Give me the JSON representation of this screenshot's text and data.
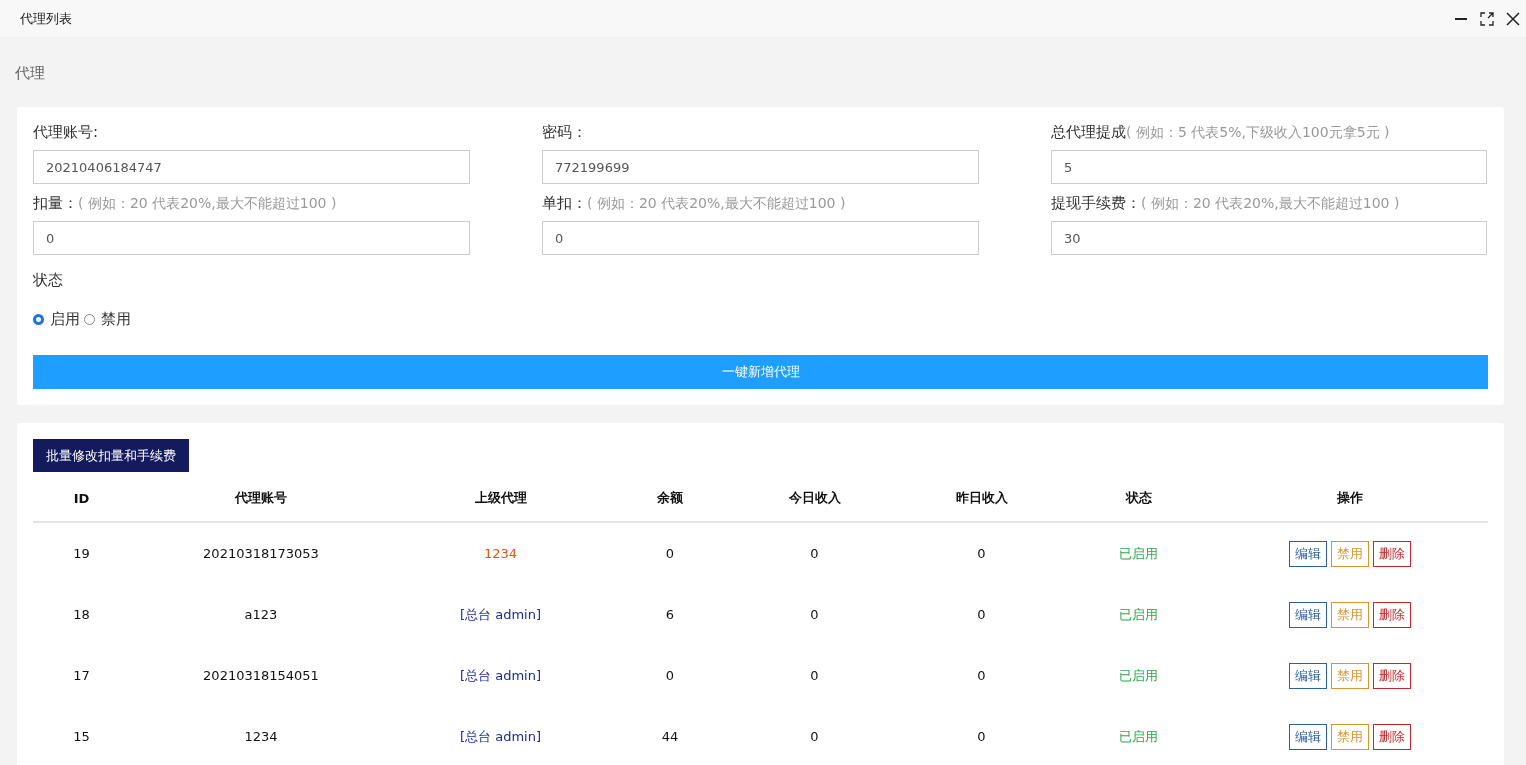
{
  "window": {
    "title": "代理列表"
  },
  "section_title": "代理",
  "form": {
    "fields": [
      {
        "label": "代理账号:",
        "value": "20210406184747"
      },
      {
        "label": "密码：",
        "value": "772199699"
      },
      {
        "label": "总代理提成",
        "hint": "( 例如：5 代表5%,下级收入100元拿5元 )",
        "value": "5"
      },
      {
        "label": "扣量：",
        "hint": "( 例如：20 代表20%,最大不能超过100 )",
        "value": "0"
      },
      {
        "label": "单扣：",
        "hint": "( 例如：20 代表20%,最大不能超过100 )",
        "value": "0"
      },
      {
        "label": "提现手续费：",
        "hint": "( 例如：20 代表20%,最大不能超过100 )",
        "value": "30"
      }
    ],
    "status_label": "状态",
    "status_options": [
      {
        "label": "启用",
        "selected": true
      },
      {
        "label": "禁用",
        "selected": false
      }
    ],
    "submit": "一键新增代理"
  },
  "batch_button": "批量修改扣量和手续费",
  "table": {
    "columns": [
      "ID",
      "代理账号",
      "上级代理",
      "余额",
      "今日收入",
      "昨日收入",
      "状态",
      "操作"
    ],
    "rows": [
      {
        "id": "19",
        "account": "20210318173053",
        "parent": "1234",
        "kind": "agent",
        "balance": "0",
        "today": "0",
        "yesterday": "0",
        "status": "已启用",
        "actions": [
          {
            "label": "编辑",
            "kind": "edit"
          },
          {
            "label": "禁用",
            "kind": "disable"
          },
          {
            "label": "删除",
            "kind": "delete"
          }
        ]
      },
      {
        "id": "18",
        "account": "a123",
        "parent": "[总台 admin]",
        "kind": "admin",
        "balance": "6",
        "today": "0",
        "yesterday": "0",
        "status": "已启用",
        "actions": [
          {
            "label": "编辑",
            "kind": "edit"
          },
          {
            "label": "禁用",
            "kind": "disable"
          },
          {
            "label": "删除",
            "kind": "delete"
          }
        ]
      },
      {
        "id": "17",
        "account": "20210318154051",
        "parent": "[总台 admin]",
        "kind": "admin",
        "balance": "0",
        "today": "0",
        "yesterday": "0",
        "status": "已启用",
        "actions": [
          {
            "label": "编辑",
            "kind": "edit"
          },
          {
            "label": "禁用",
            "kind": "disable"
          },
          {
            "label": "删除",
            "kind": "delete"
          }
        ]
      },
      {
        "id": "15",
        "account": "1234",
        "parent": "[总台 admin]",
        "kind": "admin",
        "balance": "44",
        "today": "0",
        "yesterday": "0",
        "status": "已启用",
        "actions": [
          {
            "label": "编辑",
            "kind": "edit"
          },
          {
            "label": "禁用",
            "kind": "disable"
          },
          {
            "label": "删除",
            "kind": "delete"
          }
        ]
      }
    ]
  }
}
